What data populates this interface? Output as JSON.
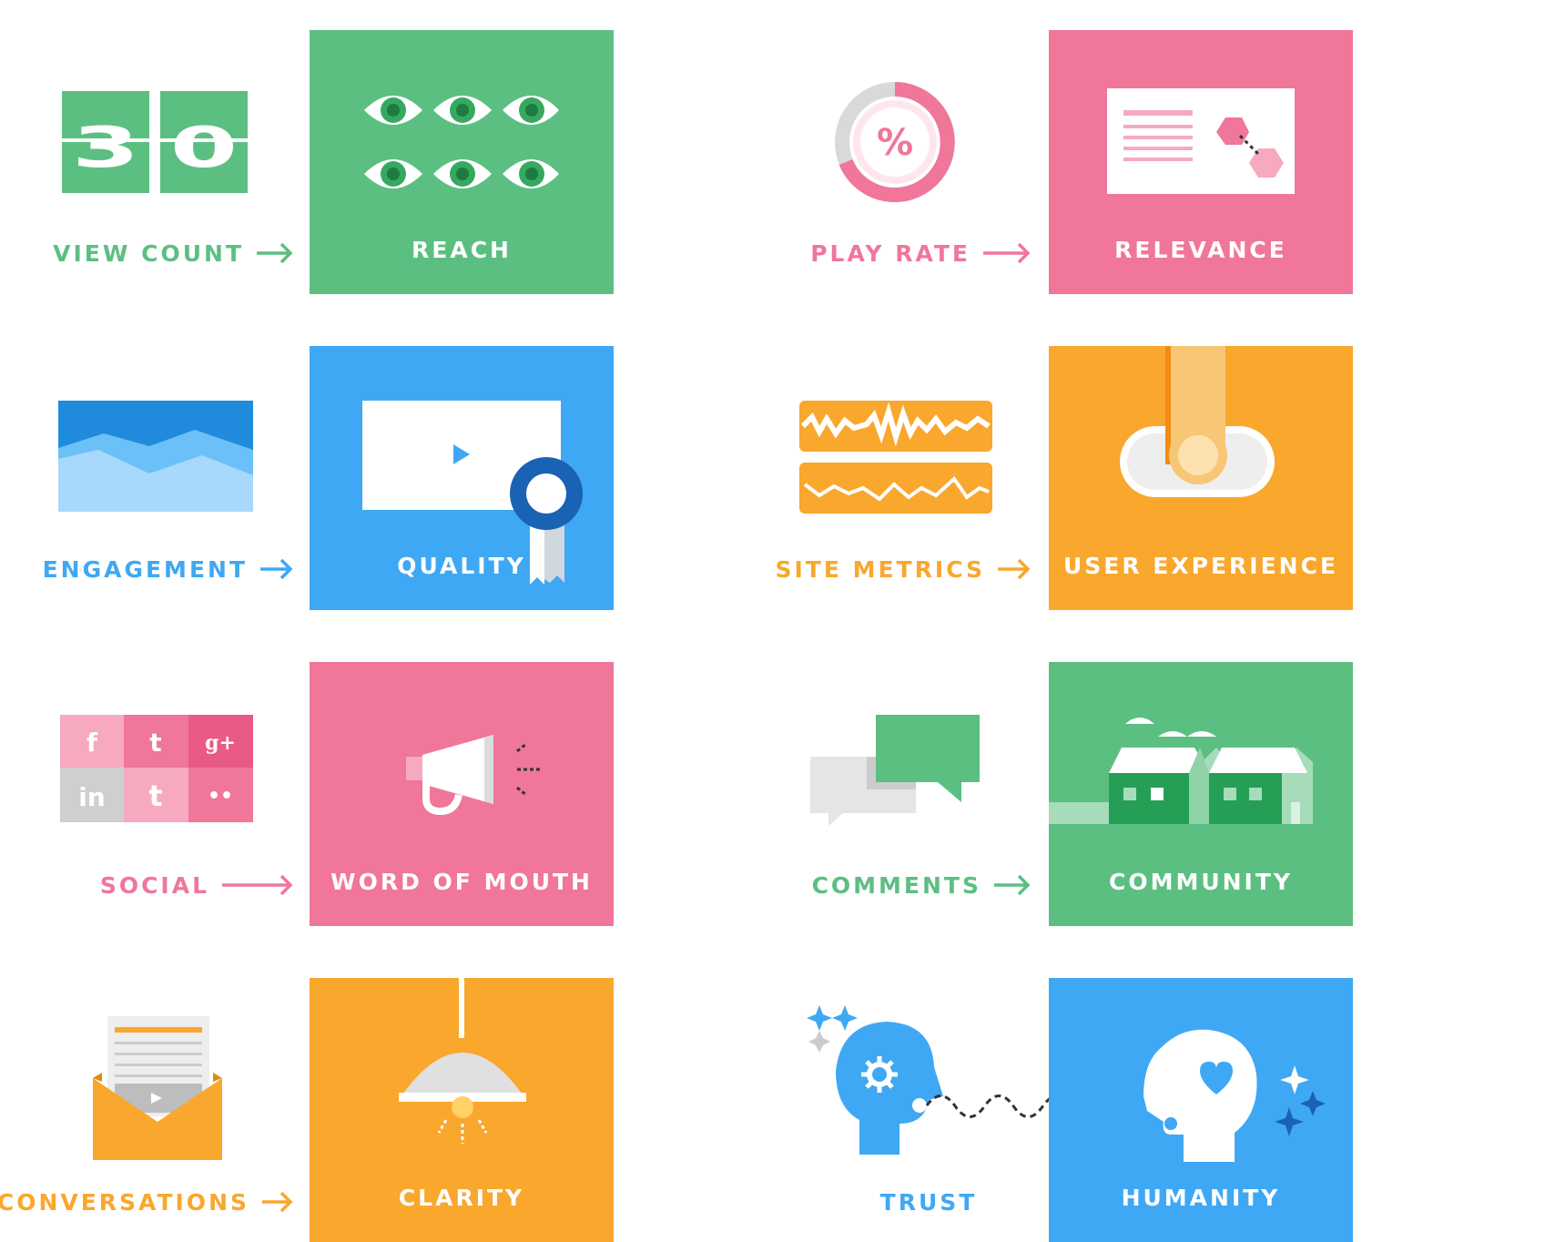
{
  "rows": [
    {
      "left": {
        "metric": "VIEW COUNT",
        "outcome": "REACH",
        "color": "#5cbf82",
        "icon": "flip-counter-icon",
        "counter_digits": "30"
      },
      "right": {
        "metric": "PLAY RATE",
        "outcome": "RELEVANCE",
        "color": "#f0769a",
        "icon": "percent-ring-icon",
        "ring_symbol": "%"
      }
    },
    {
      "left": {
        "metric": "ENGAGEMENT",
        "outcome": "QUALITY",
        "color": "#3fa8f4",
        "icon": "mountain-landscape-icon"
      },
      "right": {
        "metric": "SITE METRICS",
        "outcome": "USER EXPERIENCE",
        "color": "#f9a72d",
        "icon": "waveform-graph-icon"
      }
    },
    {
      "left": {
        "metric": "SOCIAL",
        "outcome": "WORD OF MOUTH",
        "color": "#f0769a",
        "icon": "social-grid-icon"
      },
      "right": {
        "metric": "COMMENTS",
        "outcome": "COMMUNITY",
        "color": "#5cbf82",
        "icon": "speech-bubbles-icon"
      }
    },
    {
      "left": {
        "metric": "CONVERSATIONS",
        "outcome": "CLARITY",
        "color": "#f9a72d",
        "icon": "envelope-letter-icon"
      },
      "right": {
        "metric": "TRUST",
        "outcome": "HUMANITY",
        "color": "#3fa8f4",
        "icon": "head-gear-icon"
      }
    }
  ],
  "social_glyphs": [
    "f",
    "t",
    "g+",
    "in",
    "t",
    "••"
  ]
}
